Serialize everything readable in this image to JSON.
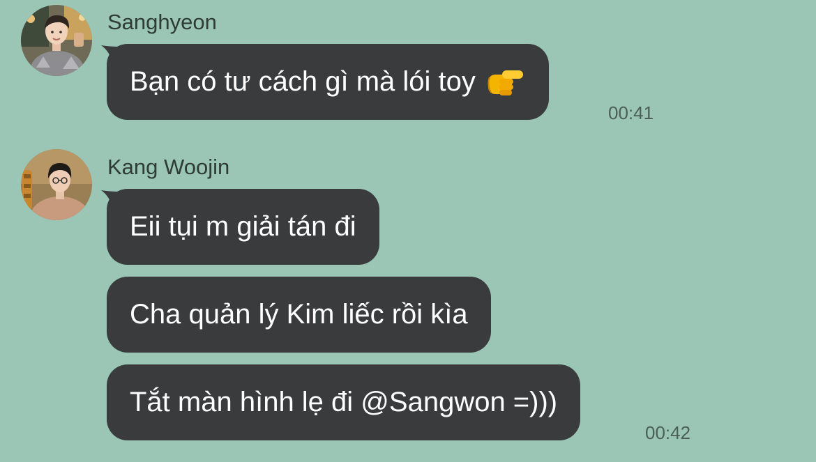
{
  "colors": {
    "background": "#9bc6b5",
    "bubble": "#3a3b3d",
    "bubble_text": "#ffffff",
    "name_text": "#2e3b36",
    "time_text": "#4b5f57"
  },
  "messages": [
    {
      "sender": "Sanghyeon",
      "avatar_icon": "profile-photo",
      "bubbles": [
        {
          "text": "Bạn có tư cách gì mà lói toy",
          "emoji": "backhand-index-pointing-right-emoji"
        }
      ],
      "time": "00:41"
    },
    {
      "sender": "Kang Woojin",
      "avatar_icon": "profile-photo",
      "bubbles": [
        {
          "text": "Eii tụi m giải tán đi"
        },
        {
          "text": "Cha quản lý Kim liếc rồi kìa"
        },
        {
          "text": "Tắt màn hình lẹ đi @Sangwon =)))"
        }
      ],
      "time": "00:42"
    }
  ]
}
